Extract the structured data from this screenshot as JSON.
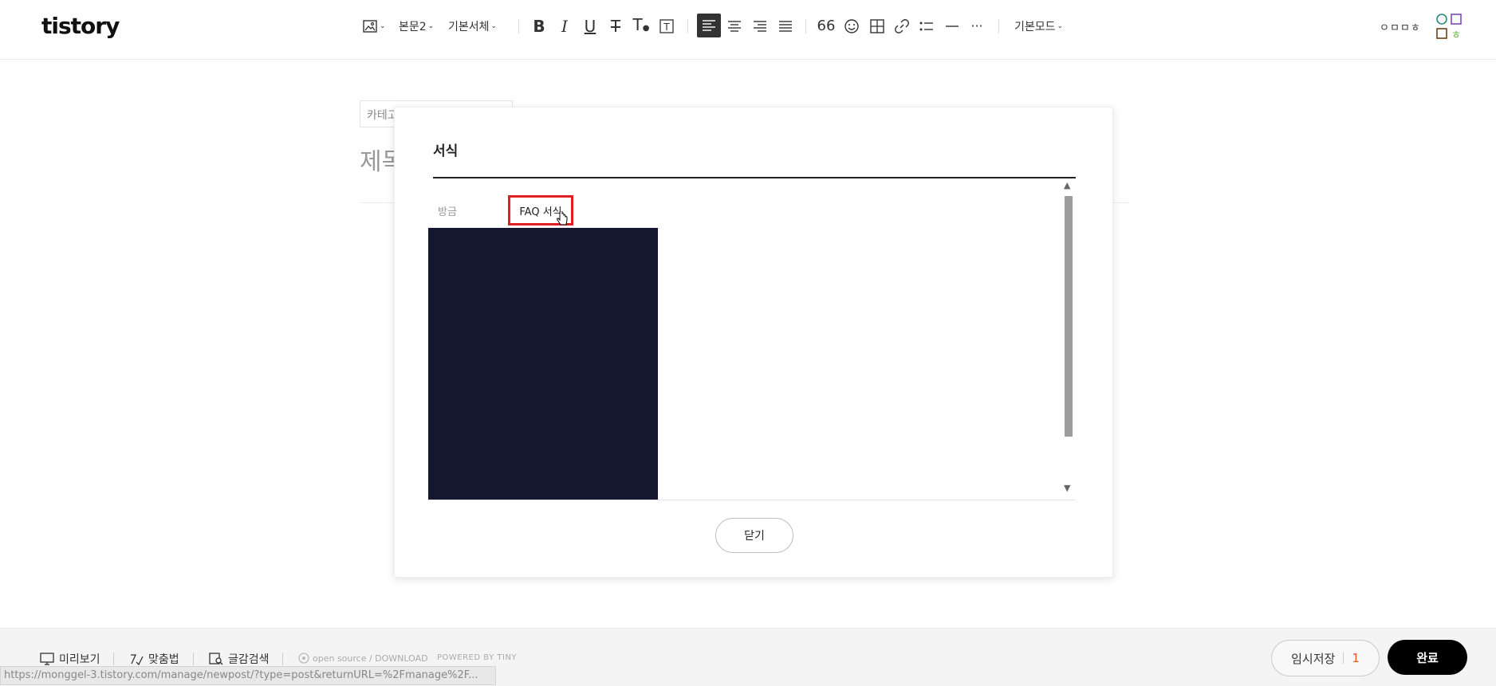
{
  "app": {
    "logo": "tistory"
  },
  "toolbar": {
    "image_label": "",
    "paragraph_style": "본문2",
    "font": "기본서체",
    "mode": "기본모드",
    "account_label": "ㅇㅁㅁㅎ",
    "icons": [
      "image-icon",
      "bold-icon",
      "italic-icon",
      "underline-icon",
      "strikethrough-icon",
      "text-color-icon",
      "text-background-icon",
      "align-left-icon",
      "align-center-icon",
      "align-right-icon",
      "align-justify-icon",
      "quote-icon",
      "emoticon-icon",
      "table-icon",
      "link-icon",
      "list-icon",
      "horizontal-rule-icon",
      "more-icon"
    ],
    "avatar_letters": [
      "ㅇ",
      "ㅁ",
      "ㅁ",
      "ㅎ"
    ]
  },
  "editor": {
    "category_placeholder": "카테고리",
    "title_placeholder": "제목을 입력하세요"
  },
  "modal": {
    "title": "서식",
    "recent_label": "방금",
    "items": [
      {
        "label": "FAQ 서식"
      }
    ],
    "close_label": "닫기"
  },
  "bottombar": {
    "preview_label": "미리보기",
    "spellcheck_label": "맞춤법",
    "search_label": "글감검색",
    "opensource_label": "open source / DOWNLOAD",
    "powered_label": "POWERED BY TINY",
    "save_label": "임시저장",
    "save_count": "1",
    "done_label": "완료"
  },
  "status": {
    "url": "https://monggel-3.tistory.com/manage/newpost/?type=post&returnURL=%2Fmanage%2F..."
  },
  "colors": {
    "accent_red": "#e02020",
    "save_count": "#f05a22",
    "preview_block": "#141730"
  }
}
